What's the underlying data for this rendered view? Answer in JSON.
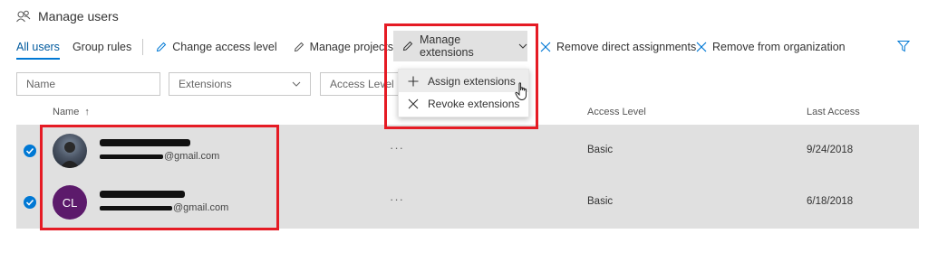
{
  "page": {
    "title": "Manage users",
    "title_icon": "users-icon"
  },
  "tabs": [
    {
      "label": "All users",
      "active": true
    },
    {
      "label": "Group rules",
      "active": false
    }
  ],
  "toolbar": {
    "change_access": "Change access level",
    "manage_projects": "Manage projects",
    "manage_extensions": "Manage extensions",
    "remove_direct": "Remove direct assignments",
    "remove_org": "Remove from organization"
  },
  "filters": {
    "name": "Name",
    "extensions": "Extensions",
    "access_level": "Access Level"
  },
  "dropdown": {
    "assign": "Assign extensions",
    "revoke": "Revoke extensions"
  },
  "table": {
    "headers": {
      "name": "Name",
      "sort_arrow": "↑",
      "access": "Access Level",
      "last": "Last Access"
    },
    "rows": [
      {
        "avatar_type": "photo",
        "email_suffix": "@gmail.com",
        "more": "···",
        "access": "Basic",
        "last_access": "9/24/2018",
        "selected": true
      },
      {
        "avatar_type": "initials",
        "initials": "CL",
        "email_suffix": "@gmail.com",
        "more": "···",
        "access": "Basic",
        "last_access": "6/18/2018",
        "selected": true
      }
    ]
  },
  "colors": {
    "accent": "#0078d4",
    "highlight": "#e51b24",
    "row_selected": "#e0e0e0",
    "avatar_purple": "#5c1a6b"
  }
}
